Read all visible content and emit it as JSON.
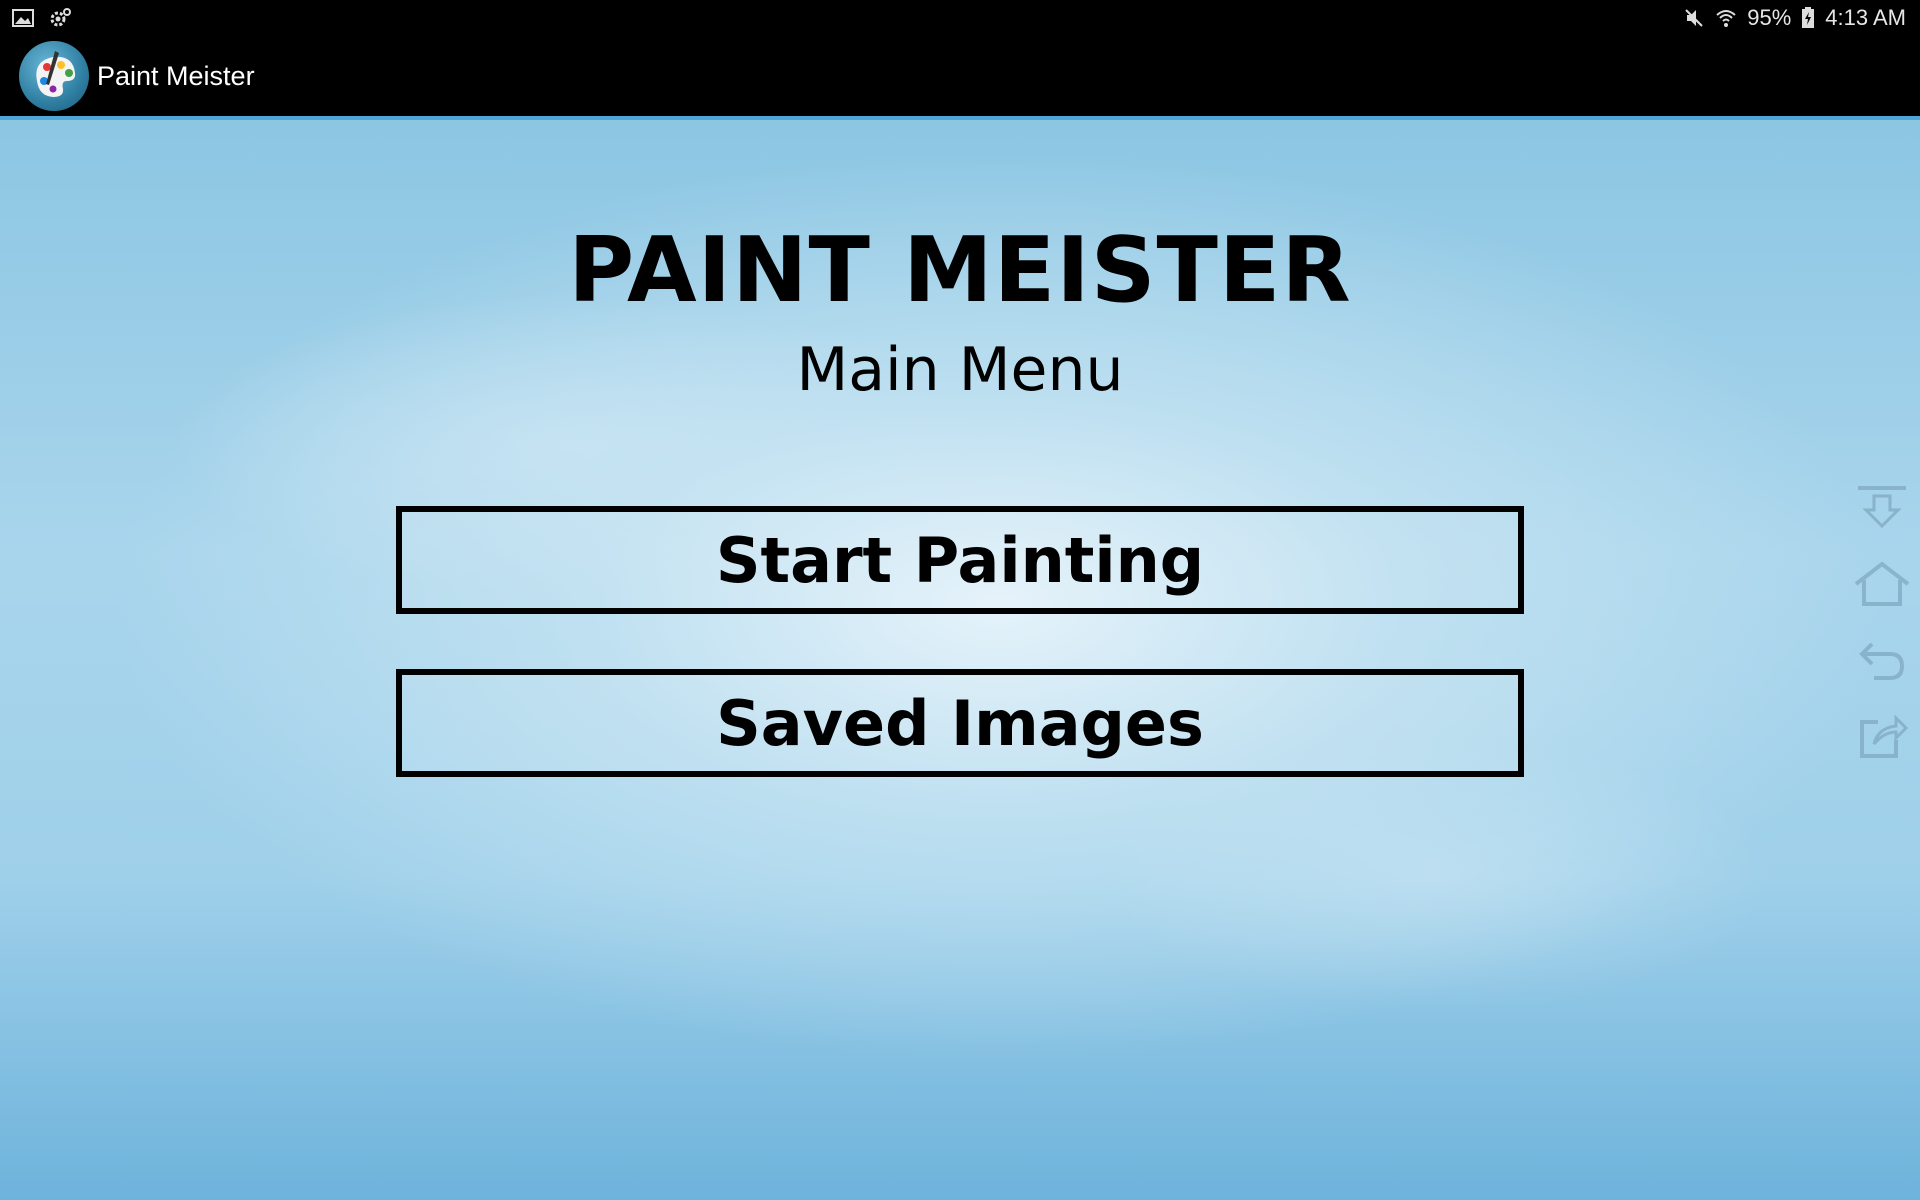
{
  "status_bar": {
    "battery": "95%",
    "time": "4:13 AM",
    "icons": [
      "gallery-icon",
      "settings-gear-icon",
      "mute-icon",
      "wifi-icon",
      "battery-charging-icon"
    ]
  },
  "action_bar": {
    "app_name": "Paint Meister",
    "icon": "palette-icon"
  },
  "main": {
    "title": "PAINT MEISTER",
    "subtitle": "Main Menu",
    "buttons": {
      "start": "Start Painting",
      "saved": "Saved Images"
    }
  },
  "side_dock": {
    "icons": [
      "download-icon",
      "home-icon",
      "back-icon",
      "share-icon"
    ]
  },
  "colors": {
    "status_bg": "#000000",
    "accent_line": "#4fa6d8",
    "button_border": "#000000",
    "background_sky": "#a9d5ec"
  }
}
